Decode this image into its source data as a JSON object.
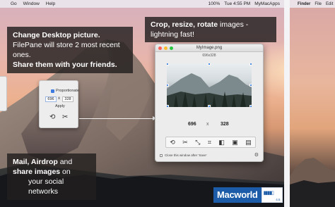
{
  "main_screen": {
    "menubar": {
      "apple": "",
      "items": [
        "Go",
        "Window",
        "Help"
      ],
      "status": [
        "100%",
        "Tue 4:55 PM",
        "MyMacApps"
      ]
    },
    "captions": {
      "desktop": {
        "line1": "Change Desktop picture.",
        "line2": "FilePane will store 2 most recent ones.",
        "line3": "Share them with your friends."
      },
      "crop": {
        "bold": "Crop, resize, rotate",
        "rest": " images - lightning fast!"
      },
      "mail": {
        "line1_bold": "Mail, Airdrop",
        "line1_rest": " and",
        "line2_bold": "share images",
        "line2_rest": " on",
        "line3": "your social networks"
      }
    },
    "resize_panel": {
      "checkbox_label": "Proportionate",
      "width_value": "696",
      "times": "x",
      "height_value": "328",
      "apply_label": "Apply",
      "icons": [
        "rotate-icon",
        "scissors-icon"
      ]
    },
    "image_window": {
      "title": "MyImage.png",
      "dimensions": "696x328",
      "width_value": "696",
      "times": "x",
      "height_value": "328",
      "toolbar_icons": [
        "rotate-icon",
        "scissors-icon",
        "scale-icon",
        "crop-icon",
        "grayscale-icon",
        "frame-icon",
        "save-icon"
      ],
      "close_option_label": "Close this window after 'Save'"
    },
    "badge": {
      "brand": "Macworld",
      "score": "4.5"
    }
  },
  "side_screen": {
    "menubar": {
      "apple": "",
      "items": [
        "Finder",
        "File",
        "Edit"
      ]
    }
  }
}
